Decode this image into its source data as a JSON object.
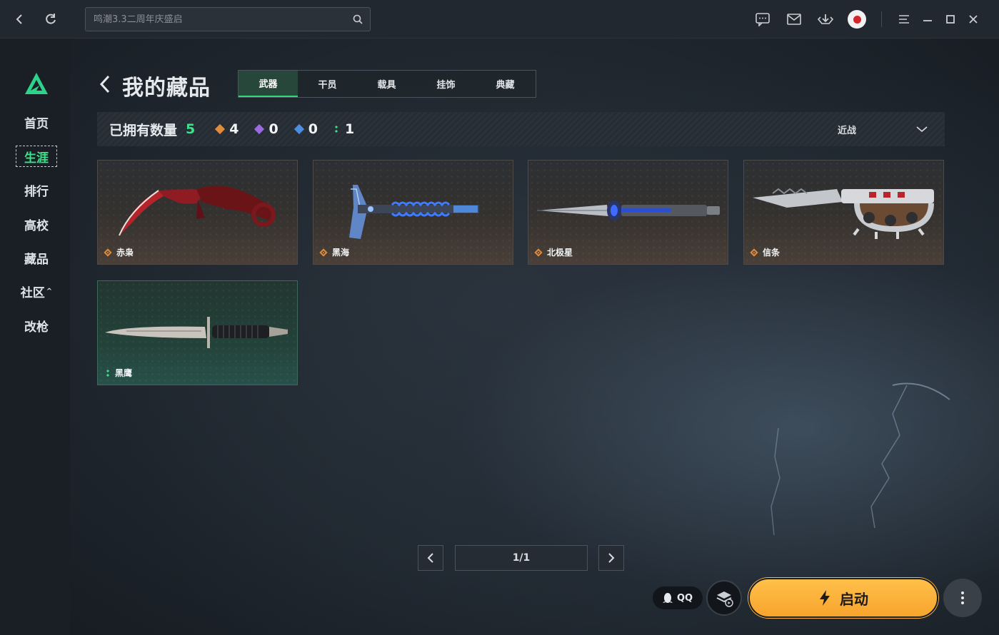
{
  "topbar": {
    "search_placeholder": "鸣潮3.3二周年庆盛启",
    "icons": [
      "back-icon",
      "refresh-icon",
      "search-icon",
      "chat-icon",
      "mail-icon",
      "download-icon",
      "avatar",
      "menu-icon",
      "minimize-icon",
      "maximize-icon",
      "close-icon"
    ]
  },
  "sidebar": {
    "items": [
      {
        "label": "首页"
      },
      {
        "label": "生涯",
        "active": true
      },
      {
        "label": "排行"
      },
      {
        "label": "高校"
      },
      {
        "label": "藏品"
      },
      {
        "label": "社区",
        "chevron": "^"
      },
      {
        "label": "改枪"
      }
    ]
  },
  "header": {
    "title": "我的藏品",
    "tabs": [
      {
        "label": "武器",
        "active": true
      },
      {
        "label": "干员"
      },
      {
        "label": "载具"
      },
      {
        "label": "挂饰"
      },
      {
        "label": "典藏"
      }
    ]
  },
  "stats": {
    "label": "已拥有数量",
    "total": "5",
    "rarities": [
      {
        "color": "#e08c3b",
        "count": "4"
      },
      {
        "color": "#9b6ae0",
        "count": "0"
      },
      {
        "color": "#4c8fe0",
        "count": "0"
      },
      {
        "color": "#3fe08a",
        "count": "1"
      }
    ],
    "sort_label": "近战"
  },
  "items": [
    {
      "name": "赤枭",
      "rarity": "orange"
    },
    {
      "name": "黑海",
      "rarity": "orange"
    },
    {
      "name": "北极星",
      "rarity": "orange"
    },
    {
      "name": "信条",
      "rarity": "orange"
    },
    {
      "name": "黑鹰",
      "rarity": "green"
    }
  ],
  "pagination": {
    "page": "1/1"
  },
  "bottom": {
    "qq_label": "QQ",
    "launch_label": "启动"
  },
  "colors": {
    "accent_green": "#3fe08a",
    "launch_orange": "#f7a42c"
  }
}
